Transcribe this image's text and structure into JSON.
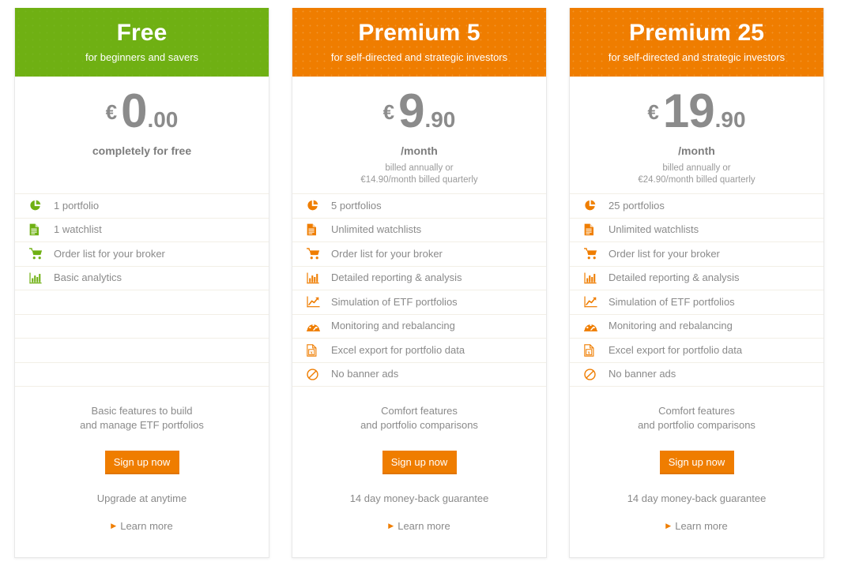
{
  "accent_colors": {
    "free_green": "#6fb013",
    "premium_orange": "#ef7d00",
    "price_gray": "#8b8b8b",
    "text_gray": "#8a8a8a",
    "divider": "#f2efe6"
  },
  "plans": [
    {
      "name": "Free",
      "tagline": "for beginners and savers",
      "header_color": "green",
      "price": {
        "currency": "€",
        "integer": "0",
        "decimal": ".00",
        "period": "completely for free",
        "note": ""
      },
      "features": [
        {
          "icon": "pie-chart-icon",
          "label": "1 portfolio"
        },
        {
          "icon": "document-icon",
          "label": "1 watchlist"
        },
        {
          "icon": "shopping-cart-icon",
          "label": "Order list for your broker"
        },
        {
          "icon": "bar-chart-icon",
          "label": "Basic analytics"
        }
      ],
      "empty_rows": 4,
      "footer": {
        "description": "Basic features to build\nand manage ETF portfolios",
        "button_label": "Sign up now",
        "guarantee": "Upgrade at anytime",
        "learn_more_label": "Learn more"
      }
    },
    {
      "name": "Premium 5",
      "tagline": "for self-directed and strategic investors",
      "header_color": "orange",
      "price": {
        "currency": "€",
        "integer": "9",
        "decimal": ".90",
        "period": "/month",
        "note": "billed annually or\n€14.90/month billed quarterly"
      },
      "features": [
        {
          "icon": "pie-chart-icon",
          "label": "5 portfolios"
        },
        {
          "icon": "document-icon",
          "label": "Unlimited watchlists"
        },
        {
          "icon": "shopping-cart-icon",
          "label": "Order list for your broker"
        },
        {
          "icon": "bar-chart-icon",
          "label": "Detailed reporting & analysis"
        },
        {
          "icon": "trending-up-icon",
          "label": "Simulation of ETF portfolios"
        },
        {
          "icon": "tachometer-icon",
          "label": "Monitoring and rebalancing"
        },
        {
          "icon": "excel-file-icon",
          "label": "Excel export for portfolio data"
        },
        {
          "icon": "ban-icon",
          "label": "No banner ads"
        }
      ],
      "empty_rows": 0,
      "footer": {
        "description": "Comfort features\nand portfolio comparisons",
        "button_label": "Sign up now",
        "guarantee": "14 day money-back guarantee",
        "learn_more_label": "Learn more"
      }
    },
    {
      "name": "Premium 25",
      "tagline": "for self-directed and strategic investors",
      "header_color": "orange",
      "price": {
        "currency": "€",
        "integer": "19",
        "decimal": ".90",
        "period": "/month",
        "note": "billed annually or\n€24.90/month billed quarterly"
      },
      "features": [
        {
          "icon": "pie-chart-icon",
          "label": "25 portfolios"
        },
        {
          "icon": "document-icon",
          "label": "Unlimited watchlists"
        },
        {
          "icon": "shopping-cart-icon",
          "label": "Order list for your broker"
        },
        {
          "icon": "bar-chart-icon",
          "label": "Detailed reporting & analysis"
        },
        {
          "icon": "trending-up-icon",
          "label": "Simulation of ETF portfolios"
        },
        {
          "icon": "tachometer-icon",
          "label": "Monitoring and rebalancing"
        },
        {
          "icon": "excel-file-icon",
          "label": "Excel export for portfolio data"
        },
        {
          "icon": "ban-icon",
          "label": "No banner ads"
        }
      ],
      "empty_rows": 0,
      "footer": {
        "description": "Comfort features\nand portfolio comparisons",
        "button_label": "Sign up now",
        "guarantee": "14 day money-back guarantee",
        "learn_more_label": "Learn more"
      }
    }
  ]
}
